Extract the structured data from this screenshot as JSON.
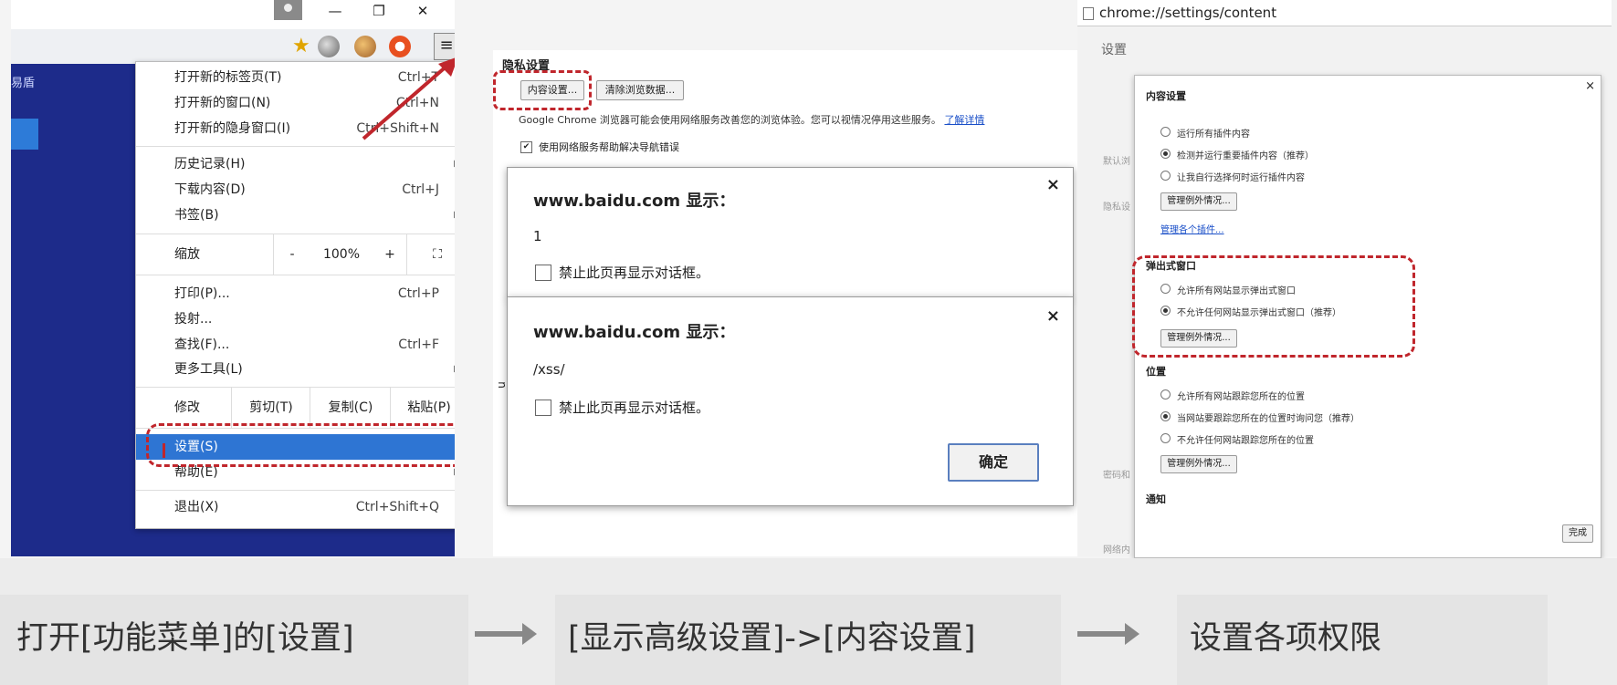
{
  "colors": {
    "accent_red": "#c0262c",
    "menu_highlight": "#2e75d3",
    "page_blue": "#1d2b8a"
  },
  "panel1": {
    "window_controls": {
      "minimize": "—",
      "restore": "❐",
      "close": "✕"
    },
    "page_fragment": "易盾",
    "menu": {
      "items1": [
        {
          "label": "打开新的标签页(T)",
          "shortcut": "Ctrl+T"
        },
        {
          "label": "打开新的窗口(N)",
          "shortcut": "Ctrl+N"
        },
        {
          "label": "打开新的隐身窗口(I)",
          "shortcut": "Ctrl+Shift+N"
        }
      ],
      "items2": [
        {
          "label": "历史记录(H)",
          "shortcut": ""
        },
        {
          "label": "下载内容(D)",
          "shortcut": "Ctrl+J"
        },
        {
          "label": "书签(B)",
          "shortcut": ""
        }
      ],
      "zoom": {
        "label": "缩放",
        "minus": "-",
        "value": "100%",
        "plus": "+",
        "fullscreen": "⛶"
      },
      "items3": [
        {
          "label": "打印(P)...",
          "shortcut": "Ctrl+P"
        },
        {
          "label": "投射...",
          "shortcut": ""
        },
        {
          "label": "查找(F)...",
          "shortcut": "Ctrl+F"
        },
        {
          "label": "更多工具(L)",
          "shortcut": ""
        }
      ],
      "edit": {
        "label": "修改",
        "cut": "剪切(T)",
        "copy": "复制(C)",
        "paste": "粘贴(P)"
      },
      "settings": "设置(S)",
      "help": "帮助(E)",
      "exit": {
        "label": "退出(X)",
        "shortcut": "Ctrl+Shift+Q"
      }
    }
  },
  "panel2": {
    "section_title": "隐私设置",
    "content_settings_btn": "内容设置...",
    "clear_data_btn": "清除浏览数据...",
    "description": "Google Chrome 浏览器可能会使用网络服务改善您的浏览体验。您可以视情况停用这些服务。",
    "learn_more": "了解详情",
    "nav_help_label": "使用网络服务帮助解决导航错误",
    "side_glyph": "n",
    "dialog1": {
      "title": "www.baidu.com 显示：",
      "message": "1",
      "checkbox_label": "禁止此页再显示对话框。",
      "close": "×"
    },
    "dialog2": {
      "title": "www.baidu.com 显示：",
      "message": "/xss/",
      "checkbox_label": "禁止此页再显示对话框。",
      "close": "×",
      "ok": "确定"
    }
  },
  "panel3": {
    "address": "chrome://settings/content",
    "page_title": "设置",
    "bg_labels": [
      "默认浏",
      "隐私设",
      "密码和",
      "网络内"
    ],
    "content_settings": {
      "title": "内容设置",
      "close": "×",
      "plugins_options": [
        "运行所有插件内容",
        "检测并运行重要插件内容（推荐）",
        "让我自行选择何时运行插件内容"
      ],
      "manage_exceptions": "管理例外情况...",
      "manage_plugins": "管理各个插件...",
      "popups_title": "弹出式窗口",
      "popups_options": [
        "允许所有网站显示弹出式窗口",
        "不允许任何网站显示弹出式窗口（推荐）"
      ],
      "location_title": "位置",
      "location_options": [
        "允许所有网站跟踪您所在的位置",
        "当网站要跟踪您所在的位置时询问您（推荐）",
        "不允许任何网站跟踪您所在的位置"
      ],
      "notifications_title": "通知",
      "done": "完成"
    }
  },
  "steps": [
    "打开[功能菜单]的[设置]",
    "[显示高级设置]->[内容设置]",
    "设置各项权限"
  ]
}
